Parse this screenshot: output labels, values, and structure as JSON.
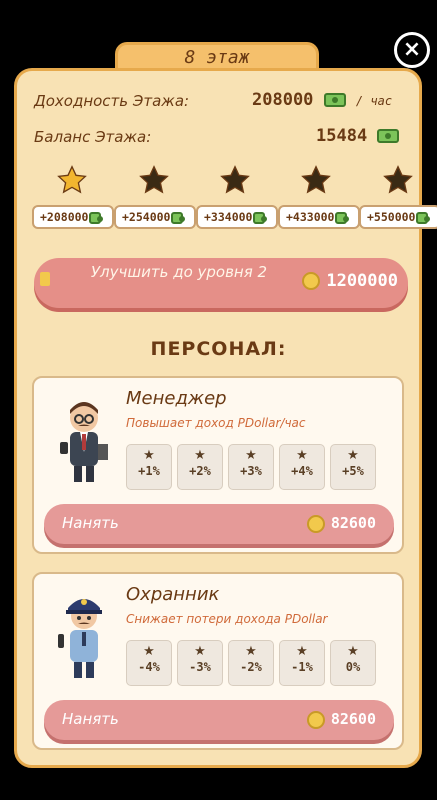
{
  "header": {
    "title": "8 этаж"
  },
  "floor": {
    "income_label": "Доходность Этажа:",
    "income_value": "208000",
    "income_unit": "/ час",
    "balance_label": "Баланс Этажа:",
    "balance_value": "15484"
  },
  "levels": [
    {
      "value": "+208000",
      "active": true
    },
    {
      "value": "+254000",
      "active": false
    },
    {
      "value": "+334000",
      "active": false
    },
    {
      "value": "+433000",
      "active": false
    },
    {
      "value": "+550000",
      "active": false
    }
  ],
  "upgrade": {
    "label": "Улучшить до уровня 2",
    "price": "1200000"
  },
  "staff_title": "ПЕРСОНАЛ:",
  "staff": [
    {
      "name": "Менеджер",
      "desc": "Повышает доход PDollar/час",
      "levels": [
        "+1%",
        "+2%",
        "+3%",
        "+4%",
        "+5%"
      ],
      "hire_label": "Нанять",
      "price": "82600"
    },
    {
      "name": "Охранник",
      "desc": "Снижает потери дохода PDollar",
      "levels": [
        "-4%",
        "-3%",
        "-2%",
        "-1%",
        "0%"
      ],
      "hire_label": "Нанять",
      "price": "82600"
    }
  ],
  "colors": {
    "accent": "#e6a94c",
    "panel": "#f8e2b4",
    "star_active": "#f2b62f",
    "star_inactive": "#3a2a14",
    "button": "#e58f88"
  },
  "icons": {
    "close": "close-icon",
    "currency": "dollar-bill-icon",
    "coin": "coin-icon",
    "star": "star-icon",
    "lock": "lock-icon"
  }
}
